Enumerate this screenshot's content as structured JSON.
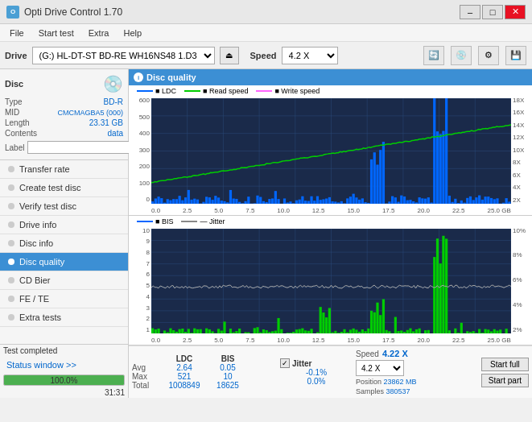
{
  "titleBar": {
    "title": "Opti Drive Control 1.70",
    "minimizeBtn": "–",
    "maximizeBtn": "□",
    "closeBtn": "✕"
  },
  "menuBar": {
    "items": [
      "File",
      "Start test",
      "Extra",
      "Help"
    ]
  },
  "driveBar": {
    "driveLabel": "Drive",
    "driveValue": "(G:) HL-DT-ST BD-RE  WH16NS48 1.D3",
    "speedLabel": "Speed",
    "speedValue": "4.2 X"
  },
  "disc": {
    "typeLabel": "Type",
    "typeValue": "BD-R",
    "midLabel": "MID",
    "midValue": "CMCMAGBA5 (000)",
    "lengthLabel": "Length",
    "lengthValue": "23.31 GB",
    "contentsLabel": "Contents",
    "contentsValue": "data",
    "labelLabel": "Label"
  },
  "nav": {
    "items": [
      {
        "id": "transfer-rate",
        "label": "Transfer rate",
        "active": false
      },
      {
        "id": "create-test-disc",
        "label": "Create test disc",
        "active": false
      },
      {
        "id": "verify-test-disc",
        "label": "Verify test disc",
        "active": false
      },
      {
        "id": "drive-info",
        "label": "Drive info",
        "active": false
      },
      {
        "id": "disc-info",
        "label": "Disc info",
        "active": false
      },
      {
        "id": "disc-quality",
        "label": "Disc quality",
        "active": true
      },
      {
        "id": "cd-bier",
        "label": "CD Bier",
        "active": false
      },
      {
        "id": "fe-te",
        "label": "FE / TE",
        "active": false
      },
      {
        "id": "extra-tests",
        "label": "Extra tests",
        "active": false
      }
    ]
  },
  "statusWindow": {
    "label": "Status window >>",
    "progressPercent": 100,
    "progressLabel": "100.0%",
    "statusText": "Test completed",
    "time": "31:31"
  },
  "chartHeader": {
    "icon": "i",
    "title": "Disc quality"
  },
  "chart1": {
    "title": "LDC / Read speed / Write speed",
    "legend": [
      {
        "label": "LDC",
        "color": "#0066ff"
      },
      {
        "label": "Read speed",
        "color": "#00cc00"
      },
      {
        "label": "Write speed",
        "color": "#ff66ff"
      }
    ],
    "yAxisLeft": [
      "600",
      "500",
      "400",
      "300",
      "200",
      "100",
      "0"
    ],
    "yAxisRight": [
      "18X",
      "16X",
      "14X",
      "12X",
      "10X",
      "8X",
      "6X",
      "4X",
      "2X"
    ],
    "xAxis": [
      "0.0",
      "2.5",
      "5.0",
      "7.5",
      "10.0",
      "12.5",
      "15.0",
      "17.5",
      "20.0",
      "22.5",
      "25.0 GB"
    ]
  },
  "chart2": {
    "title": "BIS / Jitter",
    "legend": [
      {
        "label": "BIS",
        "color": "#0066ff"
      },
      {
        "label": "Jitter",
        "color": "#999999"
      }
    ],
    "yAxisLeft": [
      "10",
      "9",
      "8",
      "7",
      "6",
      "5",
      "4",
      "3",
      "2",
      "1"
    ],
    "yAxisRight": [
      "10%",
      "8%",
      "6%",
      "4%",
      "2%"
    ],
    "xAxis": [
      "0.0",
      "2.5",
      "5.0",
      "7.5",
      "10.0",
      "12.5",
      "15.0",
      "17.5",
      "20.0",
      "22.5",
      "25.0 GB"
    ]
  },
  "stats": {
    "columns": {
      "headers": [
        "",
        "LDC",
        "BIS",
        "",
        "Jitter",
        "Speed",
        ""
      ],
      "avg": {
        "label": "Avg",
        "ldc": "2.64",
        "bis": "0.05",
        "jitter": "-0.1%"
      },
      "max": {
        "label": "Max",
        "ldc": "521",
        "bis": "10",
        "jitter": "0.0%"
      },
      "total": {
        "label": "Total",
        "ldc": "1008849",
        "bis": "18625",
        "jitter": ""
      },
      "speed": {
        "label": "4.22 X"
      },
      "speedDropdown": "4.2 X",
      "position": {
        "label": "Position",
        "value": "23862 MB"
      },
      "samples": {
        "label": "Samples",
        "value": "380537"
      }
    },
    "startFullBtn": "Start full",
    "startPartBtn": "Start part"
  }
}
